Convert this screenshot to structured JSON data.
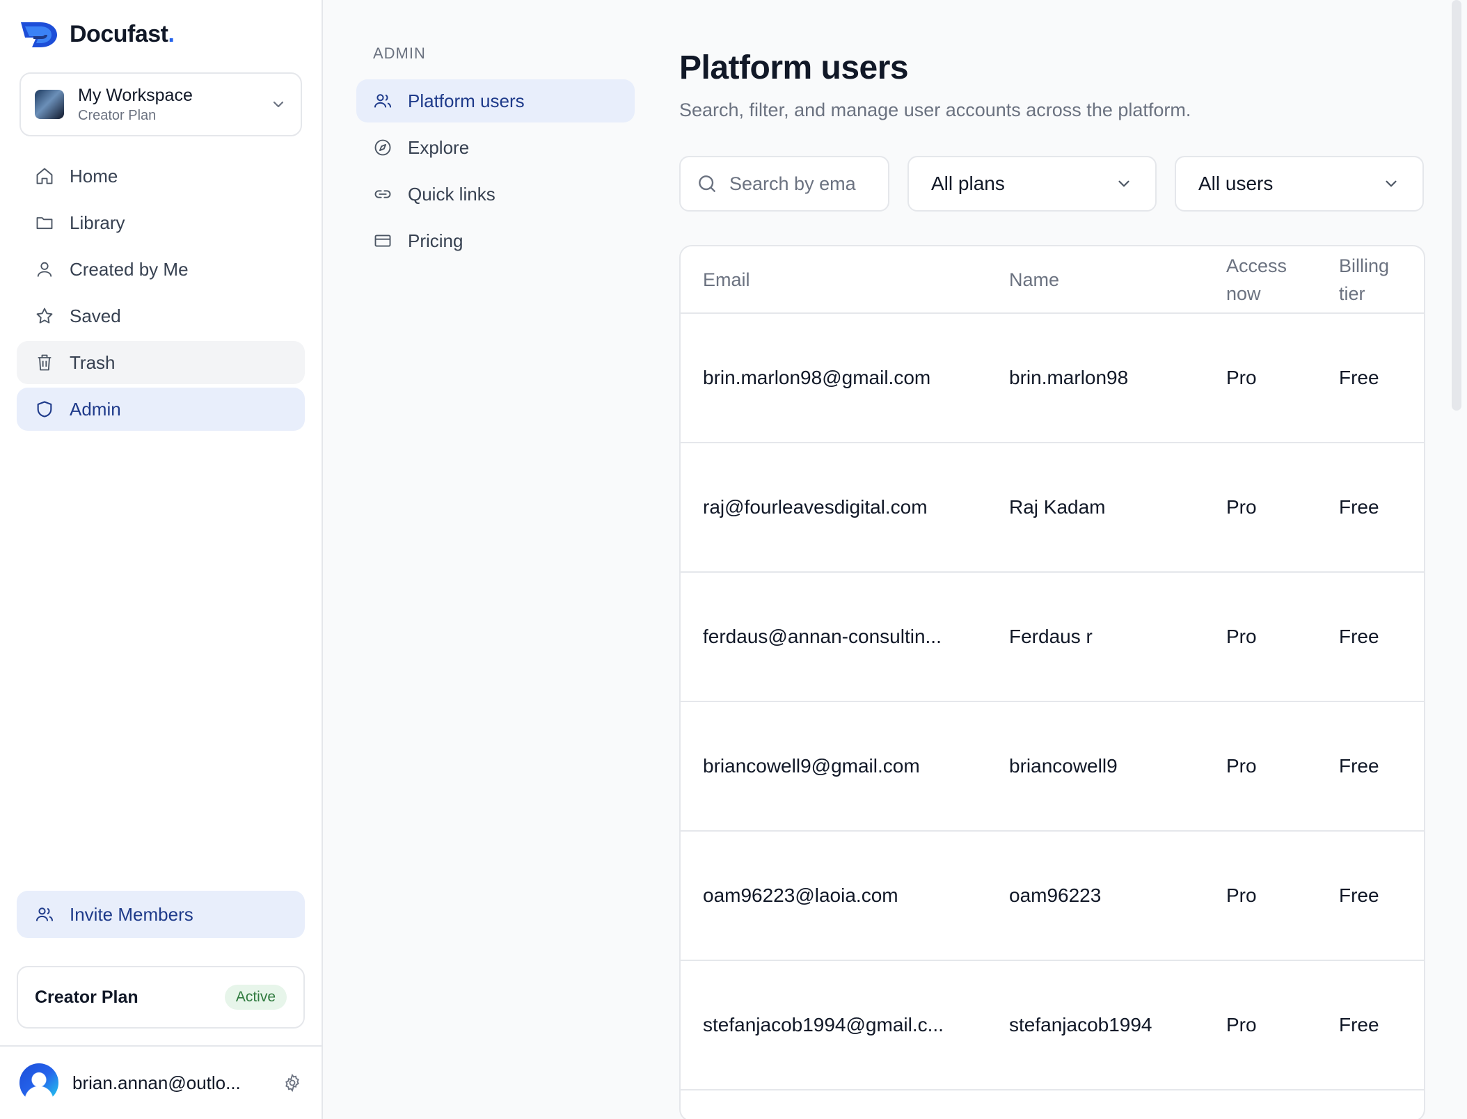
{
  "brand": {
    "name": "Docufast",
    "dot": "."
  },
  "workspace": {
    "name": "My Workspace",
    "plan": "Creator Plan"
  },
  "nav": {
    "items": [
      {
        "label": "Home",
        "icon": "home-icon"
      },
      {
        "label": "Library",
        "icon": "folder-icon"
      },
      {
        "label": "Created by Me",
        "icon": "user-icon"
      },
      {
        "label": "Saved",
        "icon": "star-icon"
      },
      {
        "label": "Trash",
        "icon": "trash-icon"
      },
      {
        "label": "Admin",
        "icon": "shield-icon"
      }
    ]
  },
  "invite": {
    "label": "Invite Members"
  },
  "plan_card": {
    "name": "Creator Plan",
    "status": "Active"
  },
  "user": {
    "email": "brian.annan@outlo..."
  },
  "subnav": {
    "title": "ADMIN",
    "items": [
      {
        "label": "Platform users",
        "icon": "users-icon"
      },
      {
        "label": "Explore",
        "icon": "compass-icon"
      },
      {
        "label": "Quick links",
        "icon": "link-icon"
      },
      {
        "label": "Pricing",
        "icon": "credit-card-icon"
      }
    ]
  },
  "page": {
    "title": "Platform users",
    "subtitle": "Search, filter, and manage user accounts across the platform."
  },
  "filters": {
    "search_placeholder": "Search by ema",
    "plan_select": "All plans",
    "user_select": "All users"
  },
  "table": {
    "headers": {
      "email": "Email",
      "name": "Name",
      "access_1": "Access",
      "access_2": "now",
      "tier_1": "Billing",
      "tier_2": "tier"
    },
    "rows": [
      {
        "email": "brin.marlon98@gmail.com",
        "name": "brin.marlon98",
        "access": "Pro",
        "tier": "Free"
      },
      {
        "email": "raj@fourleavesdigital.com",
        "name": "Raj Kadam",
        "access": "Pro",
        "tier": "Free"
      },
      {
        "email": "ferdaus@annan-consultin...",
        "name": "Ferdaus r",
        "access": "Pro",
        "tier": "Free"
      },
      {
        "email": "briancowell9@gmail.com",
        "name": "briancowell9",
        "access": "Pro",
        "tier": "Free"
      },
      {
        "email": "oam96223@laoia.com",
        "name": "oam96223",
        "access": "Pro",
        "tier": "Free"
      },
      {
        "email": "stefanjacob1994@gmail.c...",
        "name": "stefanjacob1994",
        "access": "Pro",
        "tier": "Free"
      }
    ]
  },
  "colors": {
    "accent": "#1e3a8a",
    "active_bg": "#e8eefb",
    "badge_bg": "#e7f5ea",
    "badge_text": "#2f7a3e",
    "brand_blue": "#2563eb"
  }
}
